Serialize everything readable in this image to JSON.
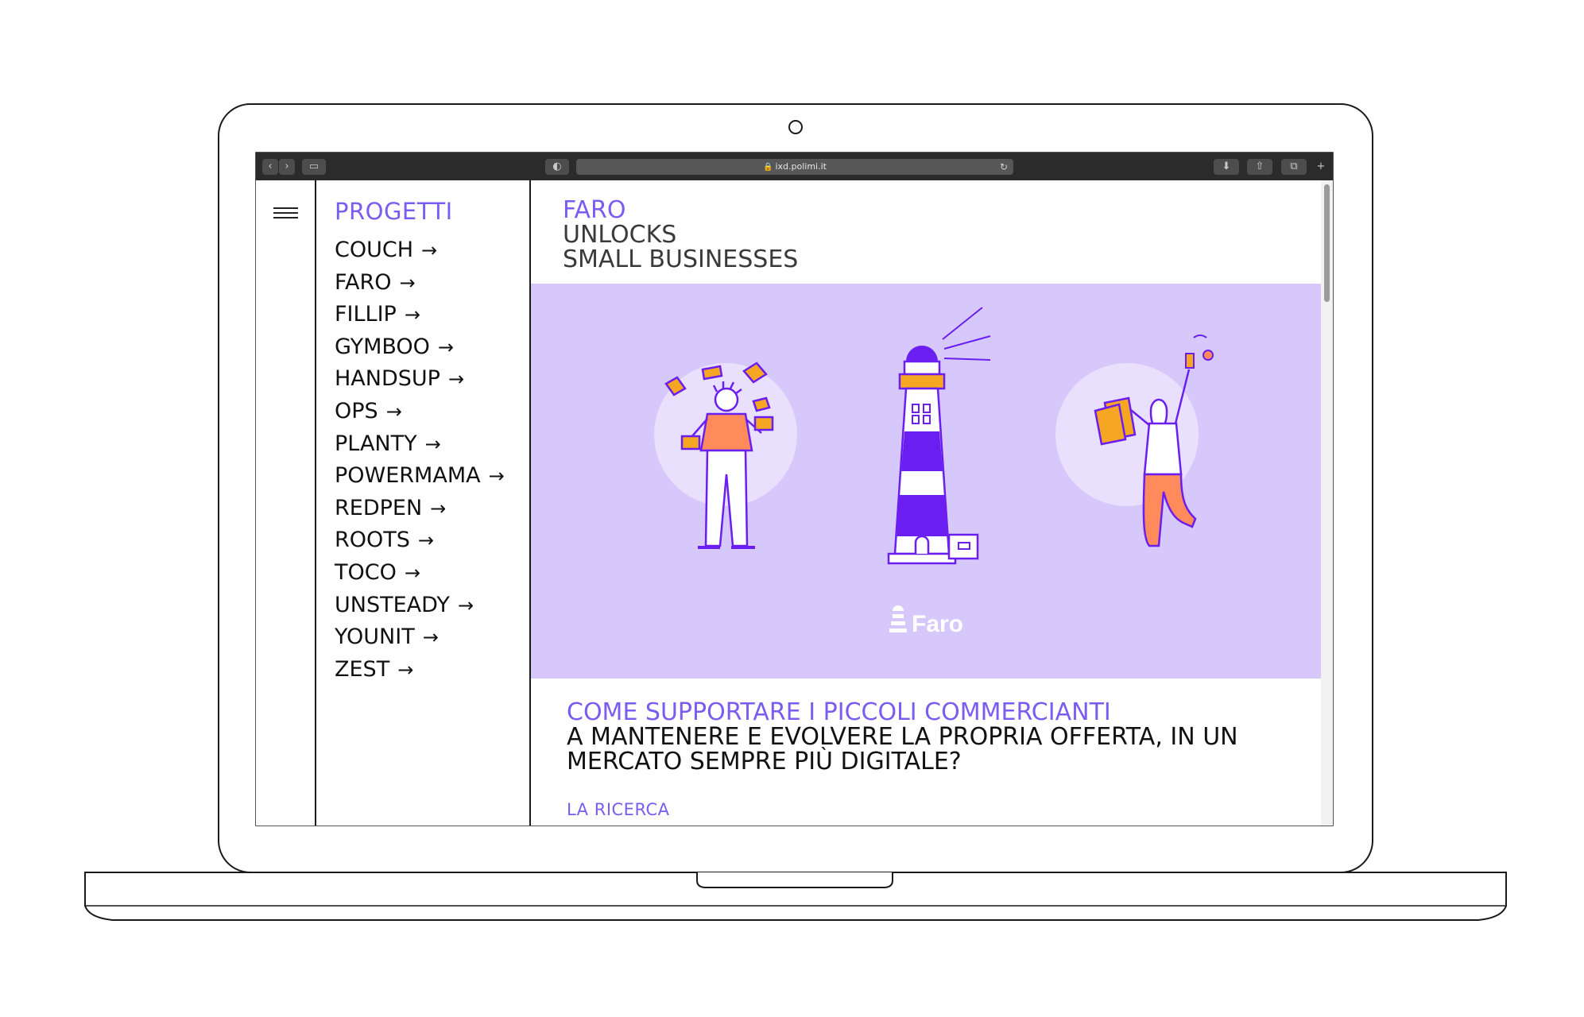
{
  "browser": {
    "url": "ixd.polimi.it",
    "colors": {
      "toolbar": "#2b2b2b",
      "button": "#4d4d4d",
      "url_bar": "#575757"
    }
  },
  "sidebar": {
    "title": "PROGETTI",
    "arrow": "→",
    "items": [
      {
        "label": "COUCH"
      },
      {
        "label": "FARO"
      },
      {
        "label": "FILLIP"
      },
      {
        "label": "GYMBOO"
      },
      {
        "label": "HANDSUP"
      },
      {
        "label": "OPS"
      },
      {
        "label": "PLANTY"
      },
      {
        "label": "POWERMAMA"
      },
      {
        "label": "REDPEN"
      },
      {
        "label": "ROOTS"
      },
      {
        "label": "TOCO"
      },
      {
        "label": "UNSTEADY"
      },
      {
        "label": "YOUNIT"
      },
      {
        "label": "ZEST"
      }
    ]
  },
  "hero": {
    "project": "FARO",
    "line1": "UNLOCKS",
    "line2": "SMALL BUSINESSES"
  },
  "banner": {
    "logo_text": "Faro",
    "colors": {
      "background": "#d6c8fb",
      "purple": "#6a1ef0",
      "orange": "#ff8a5c",
      "yellow": "#f5a623"
    }
  },
  "section": {
    "question_accent": "COME SUPPORTARE I PICCOLI COMMERCIANTI",
    "question_line2": "A MANTENERE E EVOLVERE LA PROPRIA OFFERTA, IN UN",
    "question_line3": "MERCATO SEMPRE PIÙ DIGITALE?",
    "subheading": "LA RICERCA"
  },
  "theme": {
    "accent": "#7a5cf0"
  }
}
